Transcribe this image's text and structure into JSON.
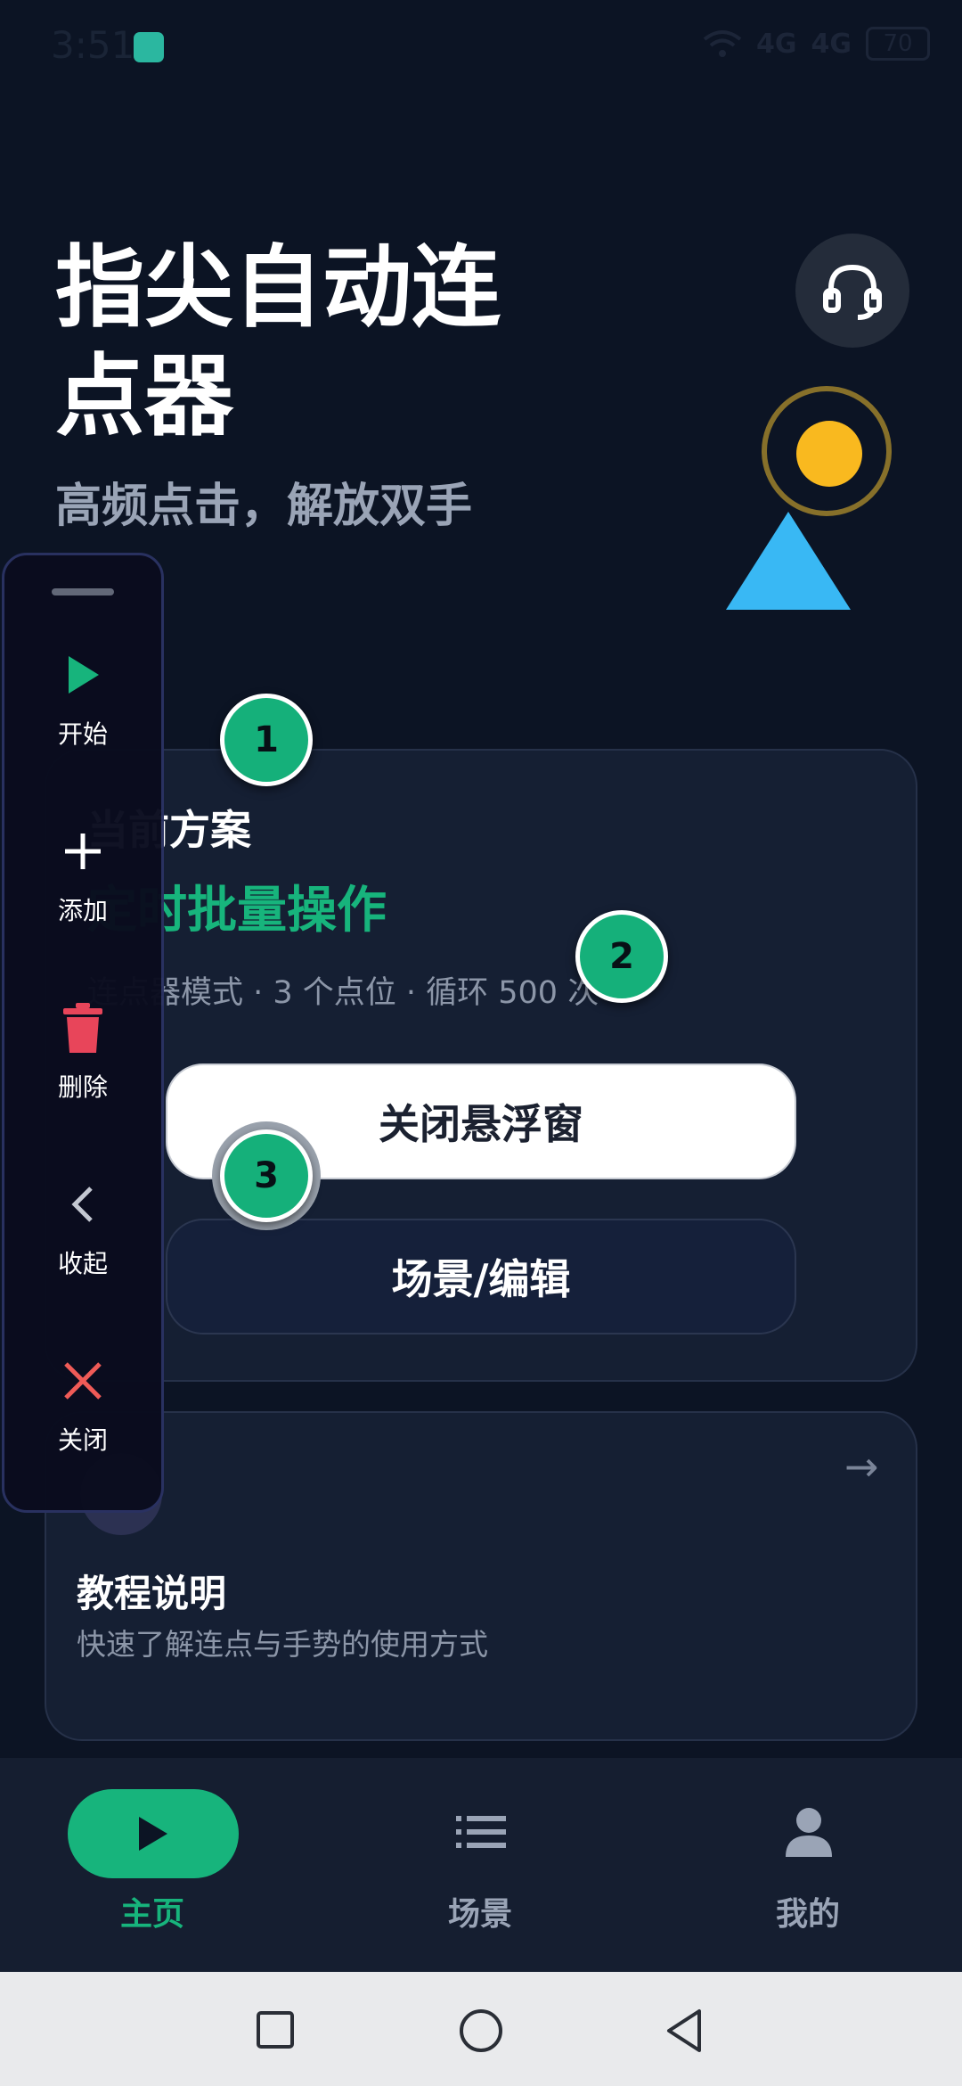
{
  "status_bar": {
    "time": "3:51",
    "signal_1": "4G",
    "signal_2": "4G",
    "battery": "70"
  },
  "hero": {
    "title": "指尖自动连点器",
    "subtitle": "高频点击，解放双手"
  },
  "plan_card": {
    "label": "当前方案",
    "name": "定时批量操作",
    "meta": "连点器模式 · 3 个点位 · 循环 500 次",
    "close_float_button": "关闭悬浮窗",
    "edit_button": "场景/编辑"
  },
  "tutorial_card": {
    "title": "教程说明",
    "description": "快速了解连点与手势的使用方式"
  },
  "floating_toolbar": {
    "items": [
      {
        "label": "开始",
        "icon": "play-icon",
        "color": "#17b47c"
      },
      {
        "label": "添加",
        "icon": "plus-icon",
        "color": "#ffffff"
      },
      {
        "label": "删除",
        "icon": "trash-icon",
        "color": "#e8455a"
      },
      {
        "label": "收起",
        "icon": "chevron-left-icon",
        "color": "#c4c8d2"
      },
      {
        "label": "关闭",
        "icon": "close-icon",
        "color": "#ef5b57"
      }
    ]
  },
  "markers": [
    "1",
    "2",
    "3"
  ],
  "bottom_nav": {
    "items": [
      {
        "label": "主页",
        "icon": "play-icon",
        "active": true
      },
      {
        "label": "场景",
        "icon": "list-icon",
        "active": false
      },
      {
        "label": "我的",
        "icon": "user-icon",
        "active": false
      }
    ]
  },
  "colors": {
    "background": "#0c1424",
    "accent": "#17b47c",
    "card": "#151f33",
    "deco_sun": "#f9b91f",
    "deco_triangle": "#39b8f4"
  }
}
